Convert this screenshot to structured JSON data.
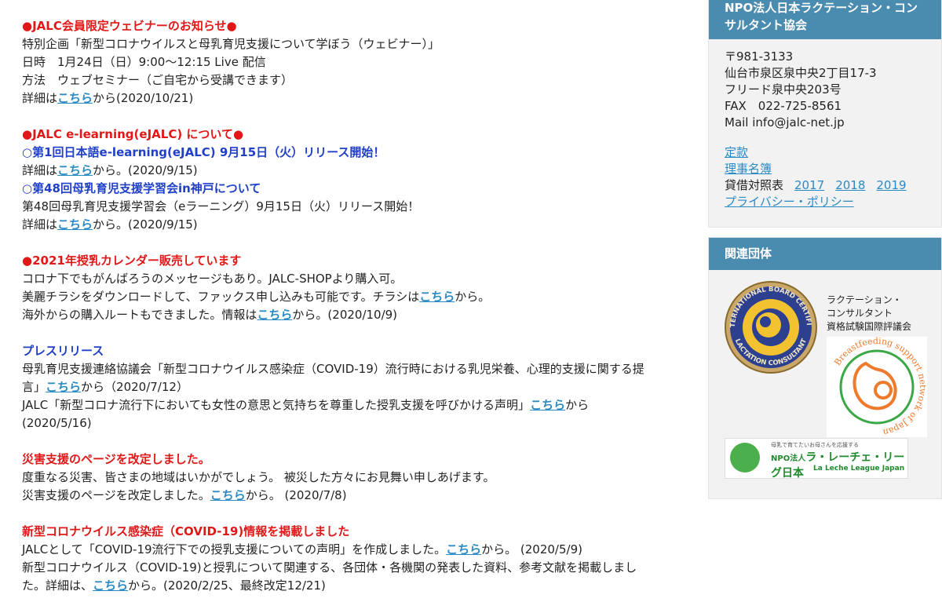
{
  "news": {
    "webinar": {
      "heading": "●JALC会員限定ウェビナーのお知らせ●",
      "line1": "特別企画「新型コロナウイルスと母乳育児支援について学ぼう（ウェビナー）」",
      "line2": "日時　1月24日（日）9:00〜12:15 Live 配信",
      "line3": "方法　ウェブセミナー（ご自宅から受講できます）",
      "detail_prefix": "詳細は",
      "link": "こちら",
      "detail_suffix": "から(2020/10/21)"
    },
    "elearning": {
      "heading": "●JALC e-learning(eJALC) について●",
      "sub1": "○第1回日本語e-learning(eJALC) 9月15日（火）リリース開始！",
      "sub1_prefix": "詳細は",
      "sub1_link": "こちら",
      "sub1_suffix": "から。(2020/9/15)",
      "sub2": "○第48回母乳育児支援学習会in神戸について",
      "sub2_line": "第48回母乳育児支援学習会（eラーニング）9月15日（火）リリース開始！",
      "sub2_prefix": "詳細は",
      "sub2_link": "こちら",
      "sub2_suffix": "から。(2020/9/15)"
    },
    "calendar": {
      "heading": "●2021年授乳カレンダー販売しています",
      "line1": "コロナ下でもがんばろうのメッセージもあり。JALC-SHOPより購入可。",
      "line2_prefix": "美麗チラシをダウンロードして、ファックス申し込みも可能です。チラシは",
      "line2_link": "こちら",
      "line2_suffix": "から。",
      "line3_prefix": "海外からの購入ルートもできました。情報は",
      "line3_link": "こちら",
      "line3_suffix": "から。(2020/10/9)"
    },
    "press": {
      "heading": "プレスリリース",
      "line1": "母乳育児支援連絡協議会「新型コロナウイルス感染症（COVID-19）流行時における乳児栄養、心理的支援に関する提",
      "line2_prefix": "言」",
      "line2_link": "こちら",
      "line2_suffix": "から（2020/7/12）",
      "line3_prefix": "JALC「新型コロナ流行下においても女性の意思と気持ちを尊重した授乳支援を呼びかける声明」",
      "line3_link": "こちら",
      "line3_suffix": "から",
      "line4": "(2020/5/16)"
    },
    "disaster": {
      "heading": "災害支援のページを改定しました。",
      "line1": "度重なる災害、皆さまの地域はいかがでしょう。 被災した方々にお見舞い申しあげます。",
      "line2_prefix": "災害支援のページを改定しました。",
      "line2_link": "こちら",
      "line2_suffix": "から。 (2020/7/8)"
    },
    "covid": {
      "heading": "新型コロナウイルス感染症（COVID-19)情報を掲載しました",
      "line1_prefix": "JALCとして「COVID-19流行下での授乳支援についての声明」を作成しました。",
      "line1_link": "こちら",
      "line1_suffix": "から。 (2020/5/9)",
      "line2": "新型コロナウイルス（COVID-19)と授乳について関連する、各団体・各機関の発表した資料、参考文献を掲載しまし",
      "line3_prefix": "た。詳細は、",
      "line3_link": "こちら",
      "line3_suffix": "から。(2020/2/25、最終改定12/21)"
    }
  },
  "sidebar": {
    "org": {
      "title_line1": "NPO法人日本ラクテーション・コン",
      "title_line2": "サルタント協会",
      "postal": "〒981-3133",
      "addr1": "仙台市泉区泉中央2丁目17-3",
      "addr2": "フリード泉中央203号",
      "fax": "FAX　022-725-8561",
      "mail": "Mail info@jalc-net.jp",
      "link_teikan": "定款",
      "link_riji": "理事名簿",
      "balance_label": "貸借対照表",
      "years": [
        "2017",
        "2018",
        "2019"
      ],
      "link_privacy": "プライバシー・ポリシー"
    },
    "related": {
      "title": "関連団体",
      "ibclc_text": [
        "ラクテーション・",
        "コンサルタント",
        "資格試験国際評議会"
      ],
      "ibclc_ring_top": "INTERNATIONAL BOARD CERTIFIED",
      "ibclc_ring_bottom": "LACTATION CONSULTANT",
      "bsn_ring": "Breastfeeding support network of Japan",
      "lll_small": "母乳で育てたいお母さんを応援する",
      "lll_prefix": "NPO法人",
      "lll_name": "ラ・レーチェ・リーグ日本",
      "lll_en": "La Leche League Japan"
    }
  },
  "colors": {
    "heading_red": "#e01818",
    "heading_blue": "#2040c8",
    "link": "#2a8ac4",
    "sidebar_header": "#4a8bb0"
  }
}
